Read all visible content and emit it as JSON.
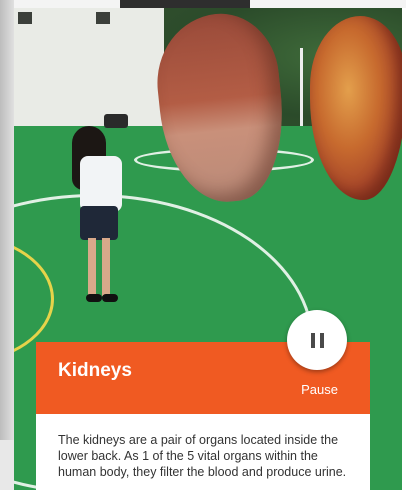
{
  "panel": {
    "title": "Kidneys",
    "description": "The kidneys are a pair of organs located inside the lower back. As 1 of the 5 vital organs within the human body, they filter the blood and produce urine."
  },
  "controls": {
    "pause_label": "Pause",
    "pause_icon": "pause-icon"
  },
  "colors": {
    "accent": "#f05a22",
    "panel_background": "#ffffff",
    "description_text": "#333333",
    "pause_button_background": "#ffffff"
  }
}
